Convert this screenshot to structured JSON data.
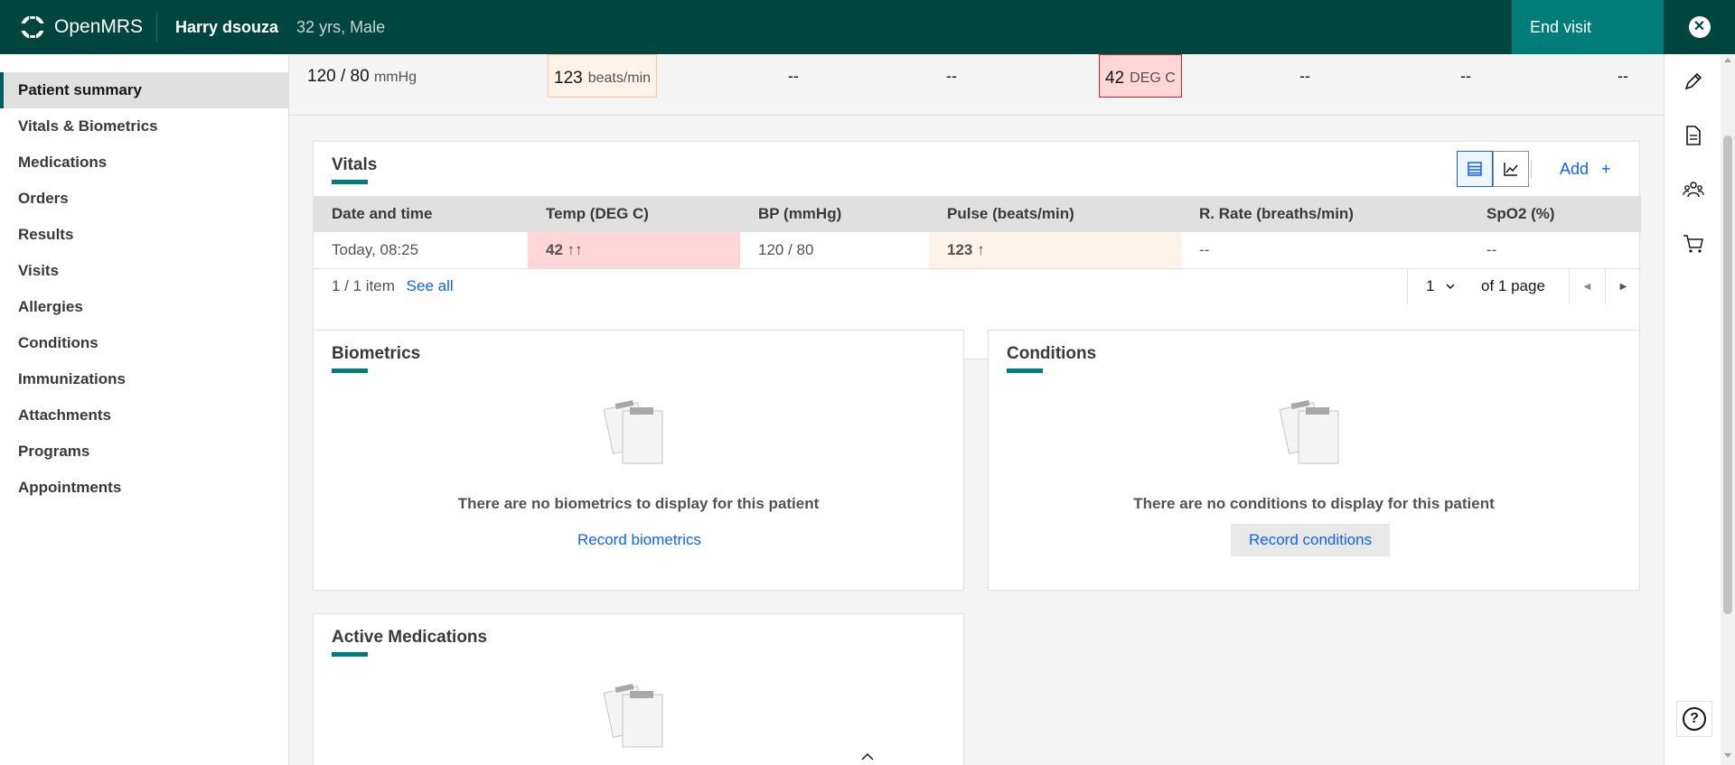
{
  "header": {
    "app_name": "OpenMRS",
    "patient_name": "Harry dsouza",
    "patient_meta": "32 yrs, Male",
    "end_visit_label": "End visit"
  },
  "leftnav": {
    "items": [
      {
        "label": "Patient summary"
      },
      {
        "label": "Vitals & Biometrics"
      },
      {
        "label": "Medications"
      },
      {
        "label": "Orders"
      },
      {
        "label": "Results"
      },
      {
        "label": "Visits"
      },
      {
        "label": "Allergies"
      },
      {
        "label": "Conditions"
      },
      {
        "label": "Immunizations"
      },
      {
        "label": "Attachments"
      },
      {
        "label": "Programs"
      },
      {
        "label": "Appointments"
      }
    ]
  },
  "vitals_strip": {
    "bp_value": "120 / 80",
    "bp_unit": "mmHg",
    "pulse_value": "123",
    "pulse_unit": "beats/min",
    "dash1": "--",
    "dash2": "--",
    "temp_value": "42",
    "temp_unit": "DEG C",
    "dash3": "--",
    "dash4": "--",
    "dash5": "--"
  },
  "vitals_card": {
    "title": "Vitals",
    "add_label": "Add",
    "add_plus": "+",
    "columns": [
      "Date and time",
      "Temp (DEG C)",
      "BP (mmHg)",
      "Pulse (beats/min)",
      "R. Rate (breaths/min)",
      "SpO2 (%)"
    ],
    "row": {
      "date": "Today, 08:25",
      "temp": "42 ↑↑",
      "bp": "120 / 80",
      "pulse": "123 ↑",
      "rrate": "--",
      "spo2": "--"
    },
    "pager": {
      "items_text": "1 / 1 item",
      "see_all": "See all",
      "page": "1",
      "of_pages": "of 1 page"
    }
  },
  "biometrics_card": {
    "title": "Biometrics",
    "empty_text": "There are no biometrics to display for this patient",
    "action": "Record biometrics"
  },
  "conditions_card": {
    "title": "Conditions",
    "empty_text": "There are no conditions to display for this patient",
    "action": "Record conditions"
  },
  "medications_card": {
    "title": "Active Medications"
  },
  "colors": {
    "header_bg": "#00463f",
    "end_visit_bg": "#007d79",
    "accent": "#007d79",
    "link": "#0f62fe",
    "critical_bg": "#ffd7d9",
    "warning_bg": "#fff2e8"
  },
  "icons": {
    "logo": "openmrs-logo-icon",
    "close": "close-icon",
    "table_view": "table-view-icon",
    "chart_view": "line-chart-icon",
    "pen": "pen-icon",
    "document": "document-icon",
    "people": "people-icon",
    "cart": "cart-icon",
    "help": "help-icon",
    "empty_state": "clipboard-empty-icon",
    "chevron_up": "chevron-up-icon",
    "chevron_down": "chevron-down-icon",
    "caret_left": "caret-left-icon",
    "caret_right": "caret-right-icon"
  }
}
